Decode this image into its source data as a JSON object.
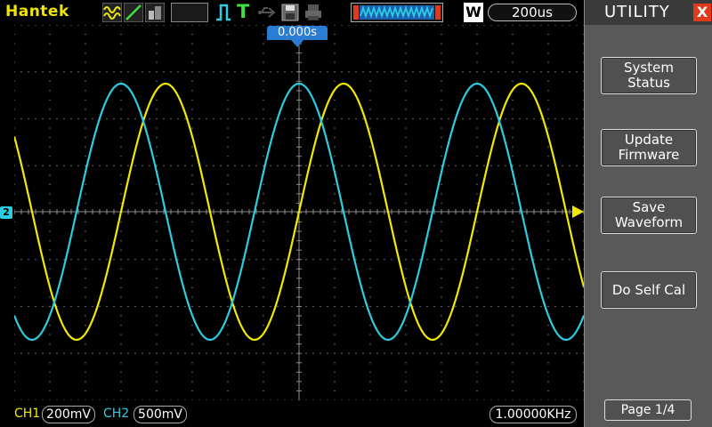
{
  "topbar": {
    "brand": "Hantek",
    "timebase": "200us",
    "window_mode": "W",
    "trigger_type": "T"
  },
  "screen": {
    "trigger_time": "0.000s",
    "ch2_marker": "2"
  },
  "bottombar": {
    "ch1_label": "CH1",
    "ch1_scale": "200mV",
    "ch2_label": "CH2",
    "ch2_scale": "500mV",
    "frequency": "1.00000KHz"
  },
  "menu": {
    "title": "UTILITY",
    "close": "X",
    "buttons": [
      {
        "label": "System\nStatus"
      },
      {
        "label": "Update\nFirmware"
      },
      {
        "label": "Save\nWaveform"
      },
      {
        "label": "Do Self Cal"
      }
    ],
    "page": "Page 1/4"
  },
  "colors": {
    "ch1": "#f0ea00",
    "ch2": "#2ccde0",
    "grid": "#8a8a8a",
    "menu_bg": "#595959",
    "accent": "#2b7cd3"
  },
  "waveforms": {
    "ch1": {
      "frequency_hz": 1000,
      "phase_deg": -90
    },
    "ch2": {
      "frequency_hz": 1000,
      "phase_deg": 0
    }
  }
}
